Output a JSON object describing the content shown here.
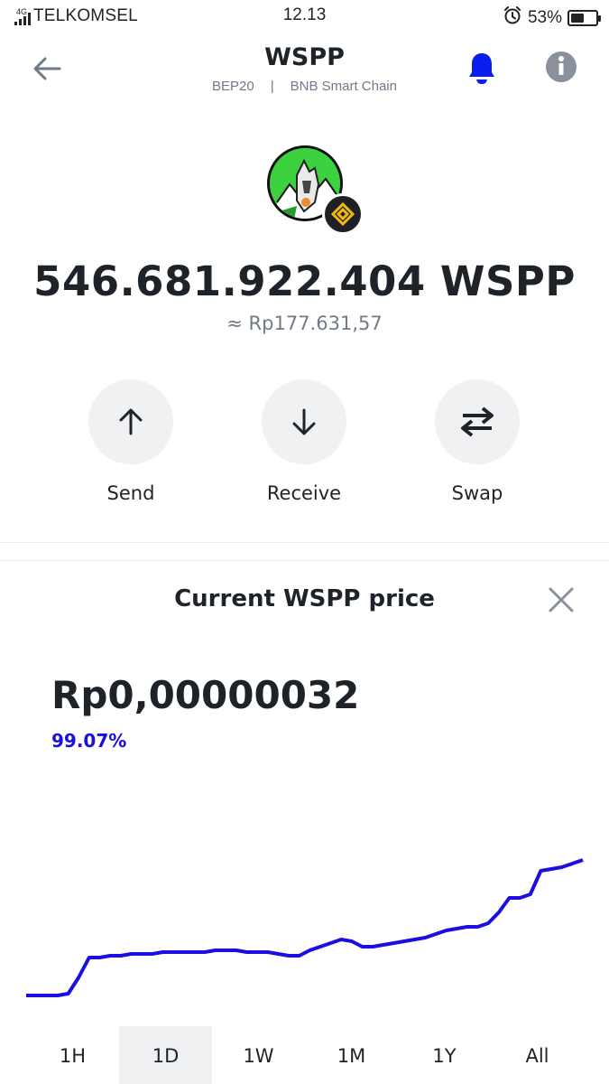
{
  "status_bar": {
    "network_type": "4G",
    "carrier": "TELKOMSEL",
    "time": "12.13",
    "battery_percent": "53%",
    "battery_level": 0.53
  },
  "header": {
    "title": "WSPP",
    "network_standard": "BEP20",
    "separator": "|",
    "chain_name": "BNB Smart Chain"
  },
  "token": {
    "balance": "546.681.922.404 WSPP",
    "fiat_value": "≈ Rp177.631,57"
  },
  "actions": {
    "send_label": "Send",
    "receive_label": "Receive",
    "swap_label": "Swap"
  },
  "price_panel": {
    "title": "Current WSPP price",
    "price": "Rp0,00000032",
    "change": "99.07%",
    "line_color": "#1a0fe0",
    "tabs": [
      {
        "label": "1H",
        "active": false
      },
      {
        "label": "1D",
        "active": true
      },
      {
        "label": "1W",
        "active": false
      },
      {
        "label": "1M",
        "active": false
      },
      {
        "label": "1Y",
        "active": false
      },
      {
        "label": "All",
        "active": false
      }
    ]
  },
  "colors": {
    "accent_blue": "#0a1ef0",
    "text_primary": "#1e2329",
    "text_secondary": "#707a8a",
    "button_bg": "#f0f1f3",
    "bnb_yellow": "#f0b90b"
  },
  "chart_data": {
    "type": "line",
    "title": "",
    "xlabel": "",
    "ylabel": "",
    "grid": false,
    "legend": "none",
    "series": [
      {
        "values": [
          0.1,
          0.1,
          0.1,
          0.1,
          0.11,
          0.2,
          0.31,
          0.31,
          0.32,
          0.32,
          0.33,
          0.33,
          0.33,
          0.34,
          0.34,
          0.34,
          0.34,
          0.34,
          0.35,
          0.35,
          0.35,
          0.34,
          0.34,
          0.34,
          0.33,
          0.32,
          0.32,
          0.35,
          0.37,
          0.39,
          0.41,
          0.4,
          0.37,
          0.37,
          0.38,
          0.39,
          0.4,
          0.41,
          0.42,
          0.44,
          0.46,
          0.47,
          0.48,
          0.48,
          0.5,
          0.56,
          0.64,
          0.64,
          0.66,
          0.79,
          0.8,
          0.81,
          0.83,
          0.85
        ]
      }
    ]
  }
}
